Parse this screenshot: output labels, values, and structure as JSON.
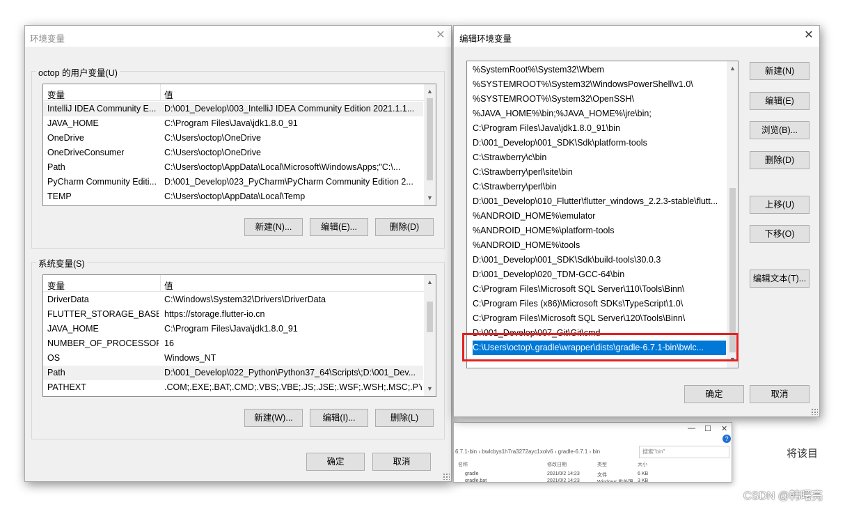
{
  "env_window": {
    "title": "环境变量",
    "close_glyph": "✕",
    "user_group_label": "octop 的用户变量(U)",
    "system_group_label": "系统变量(S)",
    "col_var": "变量",
    "col_val": "值",
    "user_vars": [
      {
        "name": "IntelliJ IDEA Community E...",
        "value": "D:\\001_Develop\\003_IntelliJ IDEA Community Edition 2021.1.1..."
      },
      {
        "name": "JAVA_HOME",
        "value": "C:\\Program Files\\Java\\jdk1.8.0_91"
      },
      {
        "name": "OneDrive",
        "value": "C:\\Users\\octop\\OneDrive"
      },
      {
        "name": "OneDriveConsumer",
        "value": "C:\\Users\\octop\\OneDrive"
      },
      {
        "name": "Path",
        "value": "C:\\Users\\octop\\AppData\\Local\\Microsoft\\WindowsApps;\"C:\\..."
      },
      {
        "name": "PyCharm Community Editi...",
        "value": "D:\\001_Develop\\023_PyCharm\\PyCharm Community Edition 2..."
      },
      {
        "name": "TEMP",
        "value": "C:\\Users\\octop\\AppData\\Local\\Temp"
      }
    ],
    "system_vars": [
      {
        "name": "DriverData",
        "value": "C:\\Windows\\System32\\Drivers\\DriverData"
      },
      {
        "name": "FLUTTER_STORAGE_BASE_...",
        "value": "https://storage.flutter-io.cn"
      },
      {
        "name": "JAVA_HOME",
        "value": "C:\\Program Files\\Java\\jdk1.8.0_91"
      },
      {
        "name": "NUMBER_OF_PROCESSORS",
        "value": "16"
      },
      {
        "name": "OS",
        "value": "Windows_NT"
      },
      {
        "name": "Path",
        "value": "D:\\001_Develop\\022_Python\\Python37_64\\Scripts\\;D:\\001_Dev..."
      },
      {
        "name": "PATHEXT",
        "value": ".COM;.EXE;.BAT;.CMD;.VBS;.VBE;.JS;.JSE;.WSF;.WSH;.MSC;.PY;.P..."
      }
    ],
    "user_buttons": {
      "new": "新建(N)...",
      "edit": "编辑(E)...",
      "delete": "删除(D)"
    },
    "system_buttons": {
      "new": "新建(W)...",
      "edit": "编辑(I)...",
      "delete": "删除(L)"
    },
    "ok": "确定",
    "cancel": "取消"
  },
  "edit_window": {
    "title": "编辑环境变量",
    "close_glyph": "✕",
    "paths": [
      "%SystemRoot%\\System32\\Wbem",
      "%SYSTEMROOT%\\System32\\WindowsPowerShell\\v1.0\\",
      "%SYSTEMROOT%\\System32\\OpenSSH\\",
      "%JAVA_HOME%\\bin;%JAVA_HOME%\\jre\\bin;",
      "C:\\Program Files\\Java\\jdk1.8.0_91\\bin",
      "D:\\001_Develop\\001_SDK\\Sdk\\platform-tools",
      "C:\\Strawberry\\c\\bin",
      "C:\\Strawberry\\perl\\site\\bin",
      "C:\\Strawberry\\perl\\bin",
      "D:\\001_Develop\\010_Flutter\\flutter_windows_2.2.3-stable\\flutt...",
      "%ANDROID_HOME%\\emulator",
      "%ANDROID_HOME%\\platform-tools",
      "%ANDROID_HOME%\\tools",
      "D:\\001_Develop\\001_SDK\\Sdk\\build-tools\\30.0.3",
      "D:\\001_Develop\\020_TDM-GCC-64\\bin",
      "C:\\Program Files\\Microsoft SQL Server\\110\\Tools\\Binn\\",
      "C:\\Program Files (x86)\\Microsoft SDKs\\TypeScript\\1.0\\",
      "C:\\Program Files\\Microsoft SQL Server\\120\\Tools\\Binn\\",
      "D:\\001_Develop\\007_Git\\Git\\cmd",
      "C:\\Users\\octop\\.gradle\\wrapper\\dists\\gradle-6.7.1-bin\\bwlc..."
    ],
    "buttons": {
      "new": "新建(N)",
      "edit": "编辑(E)",
      "browse": "浏览(B)...",
      "delete": "删除(D)",
      "up": "上移(U)",
      "down": "下移(O)",
      "edit_text": "编辑文本(T)..."
    },
    "ok": "确定",
    "cancel": "取消"
  },
  "explorer": {
    "min": "—",
    "max": "☐",
    "close": "✕",
    "address": "6.7.1-bin  ›  bwlcbys1h7ra3272ayc1xolv6  ›  gradle-6.7.1  ›  bin",
    "search_placeholder": "搜索\"bin\"",
    "col_name": "名称",
    "col_date": "修改日期",
    "col_type": "类型",
    "col_size": "大小",
    "rows": [
      {
        "name": "gradle",
        "date": "2021/0/2 14:23",
        "type": "文件",
        "size": "6 KB"
      },
      {
        "name": "gradle.bat",
        "date": "2021/0/2 14:23",
        "type": "Windows 批处理...",
        "size": "3 KB"
      }
    ]
  },
  "background": {
    "right_text": "将该目",
    "watermark": "CSDN @韩曙亮"
  },
  "colors": {
    "selection": "#0078d7",
    "highlight_box": "#e52020",
    "dialog_bg": "#f0f0f0"
  }
}
